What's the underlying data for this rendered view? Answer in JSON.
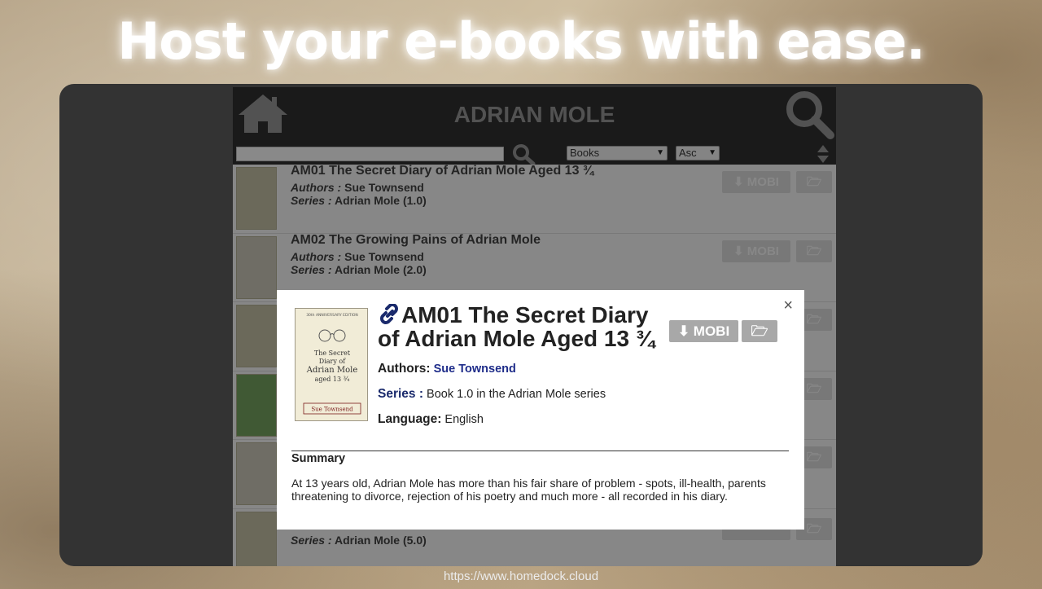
{
  "headline": "Host your e-books with ease.",
  "footer_url": "https://www.homedock.cloud",
  "app": {
    "title": "ADRIAN MOLE",
    "search_placeholder": "",
    "filter_select": "Books",
    "order_select": "Asc",
    "icons": [
      "home-icon",
      "search-icon",
      "sort-icon"
    ]
  },
  "books": [
    {
      "title": "AM01 The Secret Diary of Adrian Mole Aged 13 ¾",
      "authors_label": "Authors :",
      "authors": "Sue Townsend",
      "series_label": "Series :",
      "series": "Adrian Mole (1.0)",
      "download": "MOBI"
    },
    {
      "title": "AM02 The Growing Pains of Adrian Mole",
      "authors_label": "Authors :",
      "authors": "Sue Townsend",
      "series_label": "Series :",
      "series": "Adrian Mole (2.0)",
      "download": "MOBI"
    },
    {
      "series_label": "Series :",
      "series": "Adrian Mole (5.0)"
    }
  ],
  "modal": {
    "title": "AM01 The Secret Diary of Adrian Mole Aged 13 ¾",
    "download": "MOBI",
    "authors_label": "Authors:",
    "authors": "Sue Townsend",
    "series_label": "Series :",
    "series": "Book 1.0 in the Adrian Mole series",
    "language_label": "Language:",
    "language": "English",
    "summary_heading": "Summary",
    "summary": "At 13 years old, Adrian Mole has more than his fair share of problem - spots, ill-health, parents threatening to divorce, rejection of his poetry and much more - all recorded in his diary.",
    "close": "×",
    "cover": {
      "edition": "30th ANNIVERSARY EDITION",
      "line1": "The Secret",
      "line2": "Diary of",
      "line3": "Adrian Mole",
      "line4": "aged 13 ¾",
      "author": "Sue Townsend"
    }
  },
  "colors": {
    "topbar": "#2e2e2e",
    "link": "#1f2d8a",
    "button": "#a8a8a8"
  }
}
